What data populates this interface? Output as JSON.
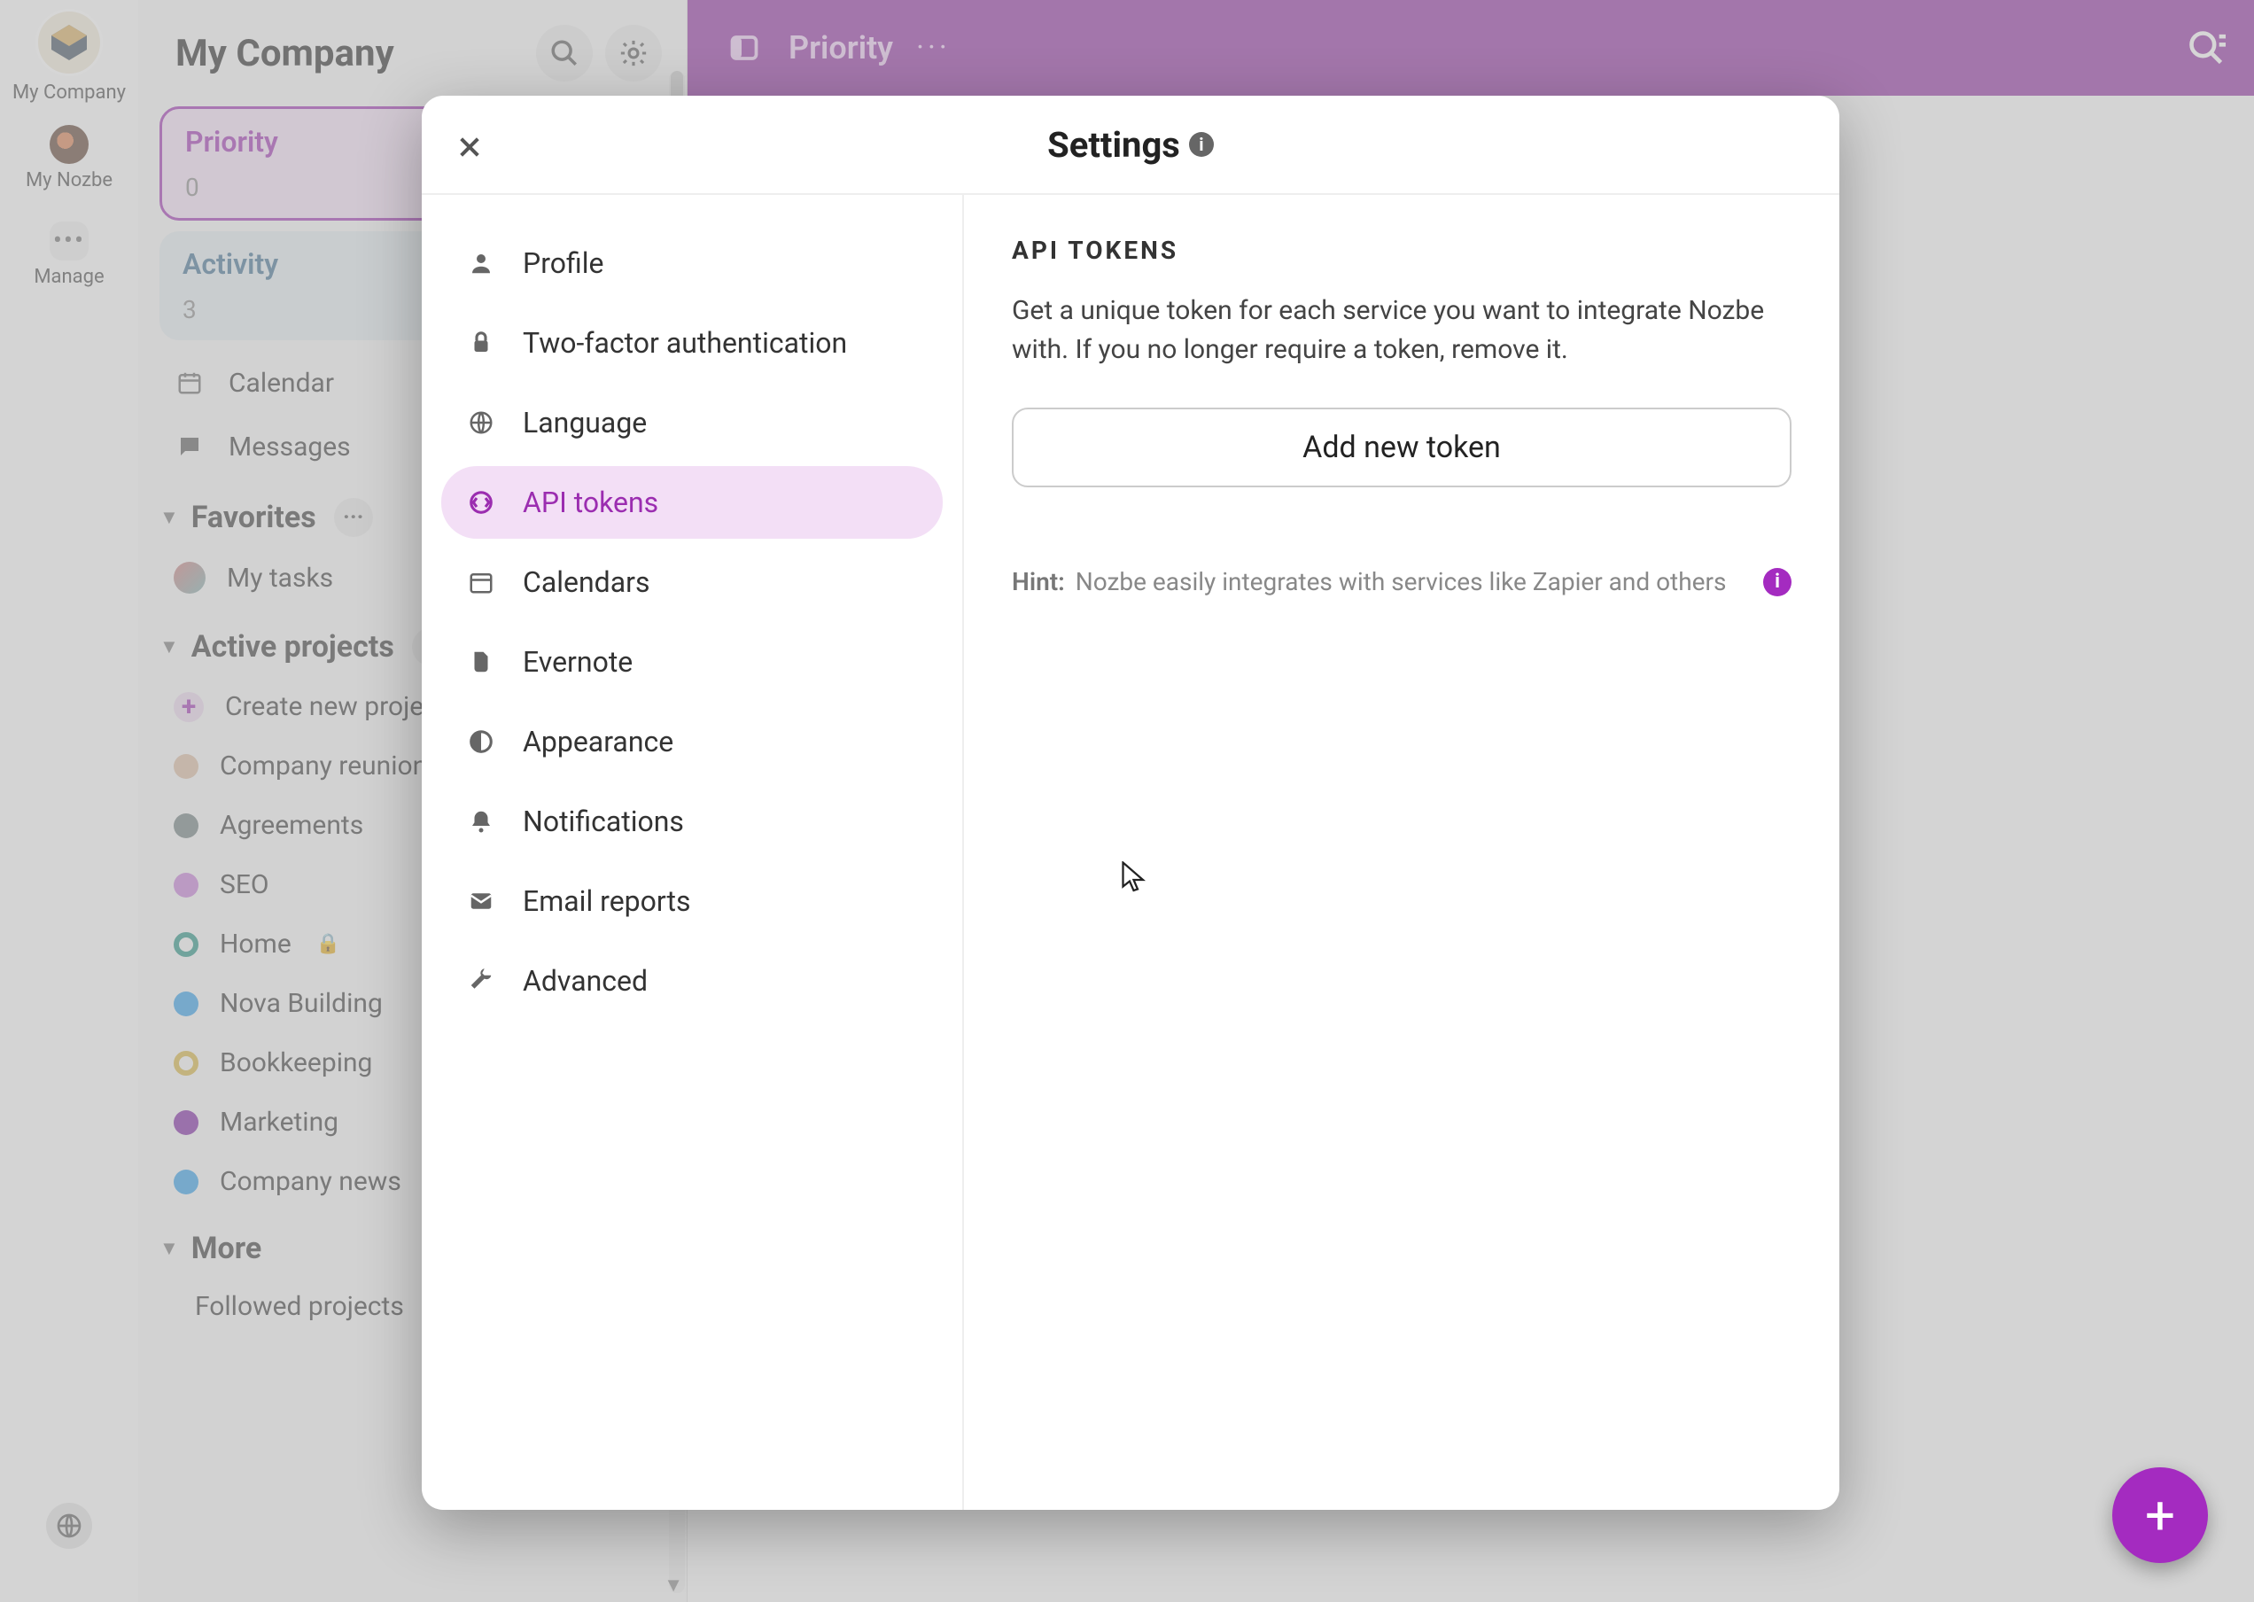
{
  "rail": {
    "company_label": "My Company",
    "nozbe_label": "My Nozbe",
    "manage_label": "Manage"
  },
  "listcol": {
    "title": "My Company",
    "priority": {
      "label": "Priority",
      "count": "0"
    },
    "activity": {
      "label": "Activity",
      "count": "3"
    },
    "calendar": "Calendar",
    "messages": "Messages",
    "favorites_label": "Favorites",
    "my_tasks": "My tasks",
    "active_label": "Active projects",
    "projects": [
      {
        "label": "Create new project",
        "color": "#e9d4ec",
        "is_create": true
      },
      {
        "label": "Company reunion",
        "color": "#d9b89d"
      },
      {
        "label": "Agreements",
        "color": "#6c7a7a"
      },
      {
        "label": "SEO",
        "color": "#c47bd6"
      },
      {
        "label": "Home",
        "color": "#1f8f7f",
        "ring": true,
        "locked": true
      },
      {
        "label": "Nova Building",
        "color": "#2e9be6"
      },
      {
        "label": "Bookkeeping",
        "color": "#d6b13c",
        "ring": true
      },
      {
        "label": "Marketing",
        "color": "#7a1fa0"
      },
      {
        "label": "Company news",
        "color": "#2e9be6"
      }
    ],
    "more_label": "More",
    "followed_label": "Followed projects"
  },
  "topbar": {
    "title": "Priority"
  },
  "modal": {
    "title": "Settings",
    "nav": [
      {
        "key": "profile",
        "label": "Profile"
      },
      {
        "key": "twofa",
        "label": "Two-factor authentication"
      },
      {
        "key": "language",
        "label": "Language"
      },
      {
        "key": "api",
        "label": "API tokens",
        "active": true
      },
      {
        "key": "calendars",
        "label": "Calendars"
      },
      {
        "key": "evernote",
        "label": "Evernote"
      },
      {
        "key": "appearance",
        "label": "Appearance"
      },
      {
        "key": "notifications",
        "label": "Notifications"
      },
      {
        "key": "email",
        "label": "Email reports"
      },
      {
        "key": "advanced",
        "label": "Advanced"
      }
    ],
    "content": {
      "heading": "API TOKENS",
      "desc": "Get a unique token for each service you want to integrate Nozbe with. If you no longer require a token, remove it.",
      "add_label": "Add new token",
      "hint_label": "Hint:",
      "hint_text": "Nozbe easily integrates with services like Zapier and others"
    }
  }
}
